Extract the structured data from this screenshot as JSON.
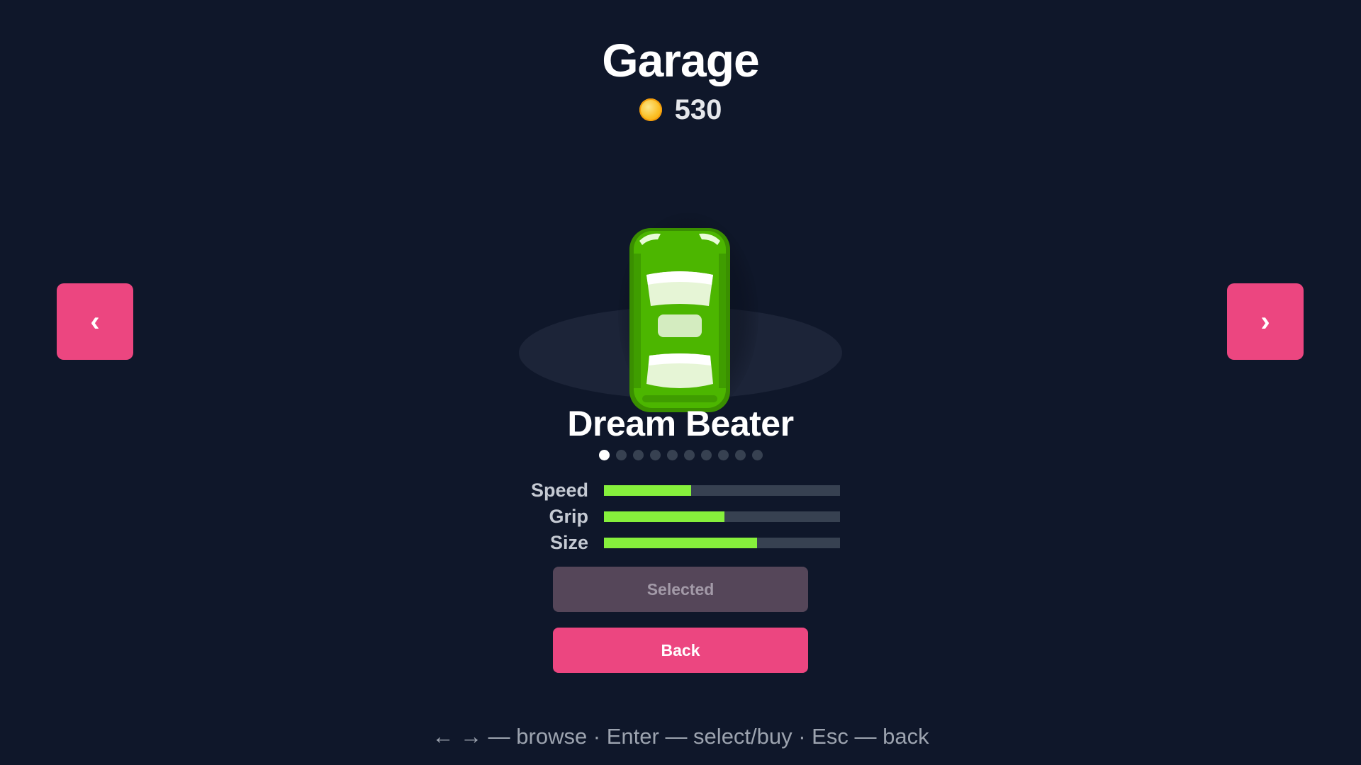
{
  "header": {
    "title": "Garage",
    "coins": "530"
  },
  "navigation": {
    "prev_label": "‹",
    "next_label": "›"
  },
  "car": {
    "name": "Dream Beater",
    "color": "#4cb600",
    "index": 1,
    "total": 10
  },
  "stats": [
    {
      "label": "Speed",
      "value": 0.37
    },
    {
      "label": "Grip",
      "value": 0.51
    },
    {
      "label": "Size",
      "value": 0.65
    }
  ],
  "buttons": {
    "selected_label": "Selected",
    "back_label": "Back"
  },
  "hint": "← → — browse · Enter — select/buy · Esc — back",
  "colors": {
    "background": "#0f172a",
    "accent": "#ec4680",
    "stat_fill": "#86f03c",
    "coin": "#fbbf24"
  },
  "icons": {
    "coin": "coin-icon"
  }
}
